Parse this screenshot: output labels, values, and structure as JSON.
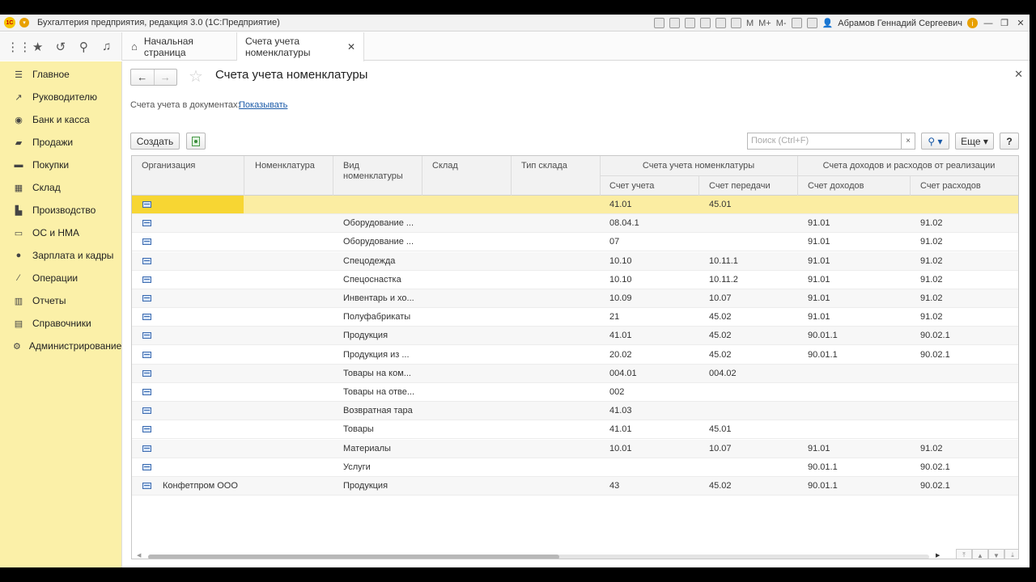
{
  "titlebar": {
    "logo": "1С",
    "title": "Бухгалтерия предприятия, редакция 3.0  (1С:Предприятие)",
    "user": "Абрамов Геннадий Сергеевич",
    "m_buttons": [
      "M",
      "M+",
      "M-"
    ]
  },
  "toppanel": {
    "icons": [
      "apps-grid-icon",
      "star-icon",
      "history-icon",
      "search-icon",
      "bell-icon"
    ],
    "tabs": [
      {
        "label": "Начальная страница"
      },
      {
        "label": "Счета учета номенклатуры"
      }
    ]
  },
  "sidebar": {
    "items": [
      {
        "label": "Главное",
        "icon": "menu-icon"
      },
      {
        "label": "Руководителю",
        "icon": "trend-icon"
      },
      {
        "label": "Банк и касса",
        "icon": "bank-icon"
      },
      {
        "label": "Продажи",
        "icon": "bag-icon"
      },
      {
        "label": "Покупки",
        "icon": "cart-icon"
      },
      {
        "label": "Склад",
        "icon": "warehouse-icon"
      },
      {
        "label": "Производство",
        "icon": "factory-icon"
      },
      {
        "label": "ОС и НМА",
        "icon": "car-icon"
      },
      {
        "label": "Зарплата и кадры",
        "icon": "person-icon"
      },
      {
        "label": "Операции",
        "icon": "operations-icon"
      },
      {
        "label": "Отчеты",
        "icon": "chart-icon"
      },
      {
        "label": "Справочники",
        "icon": "book-icon"
      },
      {
        "label": "Администрирование",
        "icon": "gear-icon"
      }
    ]
  },
  "form": {
    "title": "Счета учета номенклатуры",
    "docs_label": "Счета учета в документах:",
    "docs_link": "Показывать",
    "create_label": "Создать",
    "search_placeholder": "Поиск (Ctrl+F)",
    "more_label": "Еще",
    "help_label": "?",
    "clear_label": "×"
  },
  "table": {
    "headers": {
      "org": "Организация",
      "nomen": "Номенклатура",
      "vid_1": "Вид",
      "vid_2": "номенклатуры",
      "sklad": "Склад",
      "tip_sklada": "Тип склада",
      "group_accounts": "Счета учета номенклатуры",
      "group_income": "Счета доходов и расходов от реализации",
      "schet_ucheta": "Счет учета",
      "schet_peredachi": "Счет передачи",
      "schet_dohodov": "Счет доходов",
      "schet_rashodov": "Счет расходов"
    },
    "rows": [
      {
        "org": "",
        "vid": "",
        "su": "41.01",
        "sp": "45.01",
        "sd": "",
        "sr": ""
      },
      {
        "org": "",
        "vid": "Оборудование ...",
        "su": "08.04.1",
        "sp": "",
        "sd": "91.01",
        "sr": "91.02"
      },
      {
        "org": "",
        "vid": "Оборудование ...",
        "su": "07",
        "sp": "",
        "sd": "91.01",
        "sr": "91.02"
      },
      {
        "org": "",
        "vid": "Спецодежда",
        "su": "10.10",
        "sp": "10.11.1",
        "sd": "91.01",
        "sr": "91.02"
      },
      {
        "org": "",
        "vid": "Спецоснастка",
        "su": "10.10",
        "sp": "10.11.2",
        "sd": "91.01",
        "sr": "91.02"
      },
      {
        "org": "",
        "vid": "Инвентарь и хо...",
        "su": "10.09",
        "sp": "10.07",
        "sd": "91.01",
        "sr": "91.02"
      },
      {
        "org": "",
        "vid": "Полуфабрикаты",
        "su": "21",
        "sp": "45.02",
        "sd": "91.01",
        "sr": "91.02"
      },
      {
        "org": "",
        "vid": "Продукция",
        "su": "41.01",
        "sp": "45.02",
        "sd": "90.01.1",
        "sr": "90.02.1"
      },
      {
        "org": "",
        "vid": "Продукция из ...",
        "su": "20.02",
        "sp": "45.02",
        "sd": "90.01.1",
        "sr": "90.02.1"
      },
      {
        "org": "",
        "vid": "Товары на ком...",
        "su": "004.01",
        "sp": "004.02",
        "sd": "",
        "sr": ""
      },
      {
        "org": "",
        "vid": "Товары на отве...",
        "su": "002",
        "sp": "",
        "sd": "",
        "sr": ""
      },
      {
        "org": "",
        "vid": "Возвратная тара",
        "su": "41.03",
        "sp": "",
        "sd": "",
        "sr": ""
      },
      {
        "org": "",
        "vid": "Товары",
        "su": "41.01",
        "sp": "45.01",
        "sd": "",
        "sr": ""
      },
      {
        "org": "",
        "vid": "Материалы",
        "su": "10.01",
        "sp": "10.07",
        "sd": "91.01",
        "sr": "91.02"
      },
      {
        "org": "",
        "vid": "Услуги",
        "su": "",
        "sp": "",
        "sd": "90.01.1",
        "sr": "90.02.1"
      },
      {
        "org": "Конфетпром ООО",
        "vid": "Продукция",
        "su": "43",
        "sp": "45.02",
        "sd": "90.01.1",
        "sr": "90.02.1"
      }
    ]
  }
}
